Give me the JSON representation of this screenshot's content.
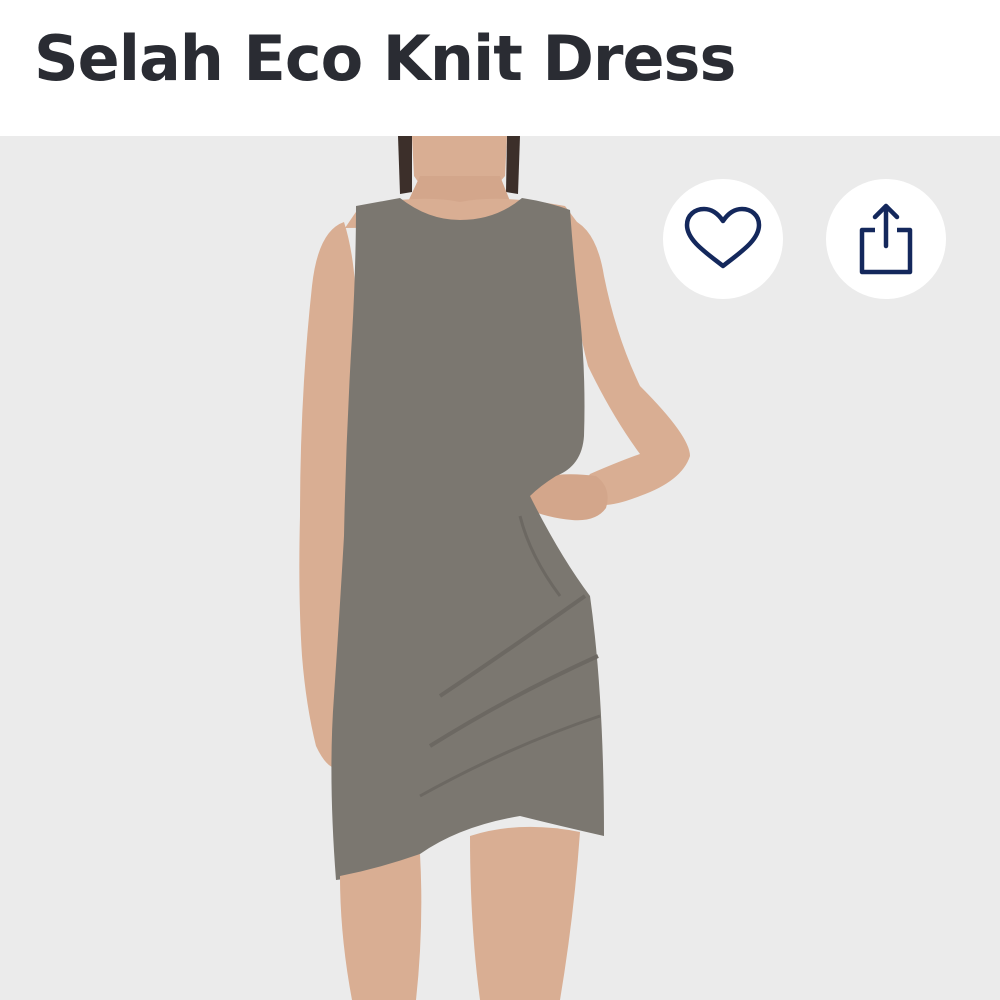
{
  "product": {
    "title": "Selah Eco Knit Dress"
  },
  "image": {
    "background_color": "#ebebeb",
    "dress_color": "#7b7770",
    "skin_color": "#d9ae93"
  },
  "actions": {
    "favorite_icon": "heart-icon",
    "share_icon": "share-icon",
    "icon_color": "#14285c"
  }
}
